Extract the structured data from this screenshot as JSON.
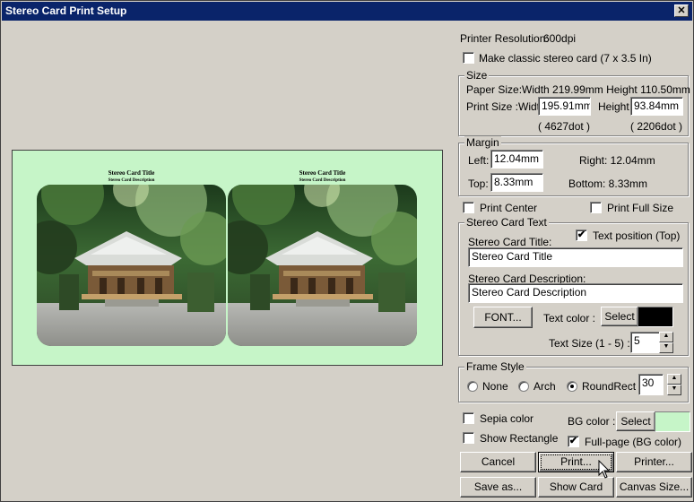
{
  "window": {
    "title": "Stereo Card Print Setup",
    "close_glyph": "✕"
  },
  "printer_resolution": {
    "label": "Printer Resolution:",
    "value": "600dpi"
  },
  "classic_card": {
    "label": "Make classic stereo card (7 x 3.5 In)",
    "checked": false
  },
  "size": {
    "legend": "Size",
    "paper_size": "Paper Size:Width 219.99mm Height 110.50mm",
    "print_size_label": "Print Size :Width",
    "width_value": "195.91mm",
    "height_label": "Height",
    "height_value": "93.84mm",
    "width_dots": "( 4627dot )",
    "height_dots": "( 2206dot )"
  },
  "margin": {
    "legend": "Margin",
    "left_label": "Left:",
    "left_value": "12.04mm",
    "top_label": "Top:",
    "top_value": "8.33mm",
    "right_text": "Right:  12.04mm",
    "bottom_text": "Bottom:   8.33mm"
  },
  "print_center": {
    "label": "Print Center",
    "checked": false
  },
  "print_full_size": {
    "label": "Print Full Size",
    "checked": false
  },
  "stereo_text": {
    "legend": "Stereo Card Text",
    "title_label": "Stereo Card Title:",
    "text_position_label": "Text position (Top)",
    "text_position_checked": true,
    "title_value": "Stereo Card Title",
    "desc_label": "Stereo Card Description:",
    "desc_value": "Stereo Card Description",
    "font_button": "FONT...",
    "text_color_label": "Text color :",
    "select_label": "Select",
    "text_color": "#000000",
    "text_size_label": "Text Size (1 - 5) :",
    "text_size_value": "5"
  },
  "frame_style": {
    "legend": "Frame Style",
    "options": [
      {
        "label": "None",
        "selected": false
      },
      {
        "label": "Arch",
        "selected": false
      },
      {
        "label": "RoundRect",
        "selected": true
      }
    ],
    "radius_value": "30"
  },
  "sepia": {
    "label": "Sepia color",
    "checked": false
  },
  "show_rectangle": {
    "label": "Show Rectangle",
    "checked": false
  },
  "bg_color": {
    "label": "BG color :",
    "select_label": "Select",
    "color": "#c6f5c8"
  },
  "full_page": {
    "label": "Full-page (BG color)",
    "checked": true
  },
  "buttons": {
    "cancel": "Cancel",
    "print": "Print...",
    "printer": "Printer...",
    "save_as": "Save as...",
    "show_card": "Show Card",
    "canvas_size": "Canvas Size..."
  },
  "preview": {
    "card_title": "Stereo Card Title",
    "card_desc": "Stereo Card Description",
    "background": "#c6f5c8"
  },
  "icons": {
    "check": "✔",
    "spin_up": "▲",
    "spin_down": "▼",
    "cursor": "mouse-pointer-icon"
  }
}
